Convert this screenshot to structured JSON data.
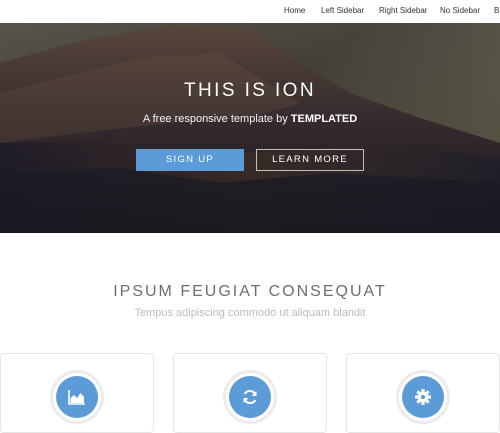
{
  "nav": {
    "items": [
      "Home",
      "Left Sidebar",
      "Right Sidebar",
      "No Sidebar",
      "B"
    ]
  },
  "hero": {
    "title": "THIS IS ION",
    "subtitle_prefix": "A free responsive template by ",
    "subtitle_brand": "TEMPLATED",
    "signup_label": "SIGN UP",
    "learn_more_label": "LEARN MORE"
  },
  "section": {
    "title": "IPSUM FEUGIAT CONSEQUAT",
    "subtitle": "Tempus adipiscing commodo ut aliquam blandit"
  },
  "cards": [
    {
      "icon": "area-chart-icon"
    },
    {
      "icon": "refresh-icon"
    },
    {
      "icon": "gear-icon"
    }
  ],
  "colors": {
    "accent": "#5a9bd8",
    "text_muted": "#b8bcc0",
    "heading": "#6a6e73"
  }
}
